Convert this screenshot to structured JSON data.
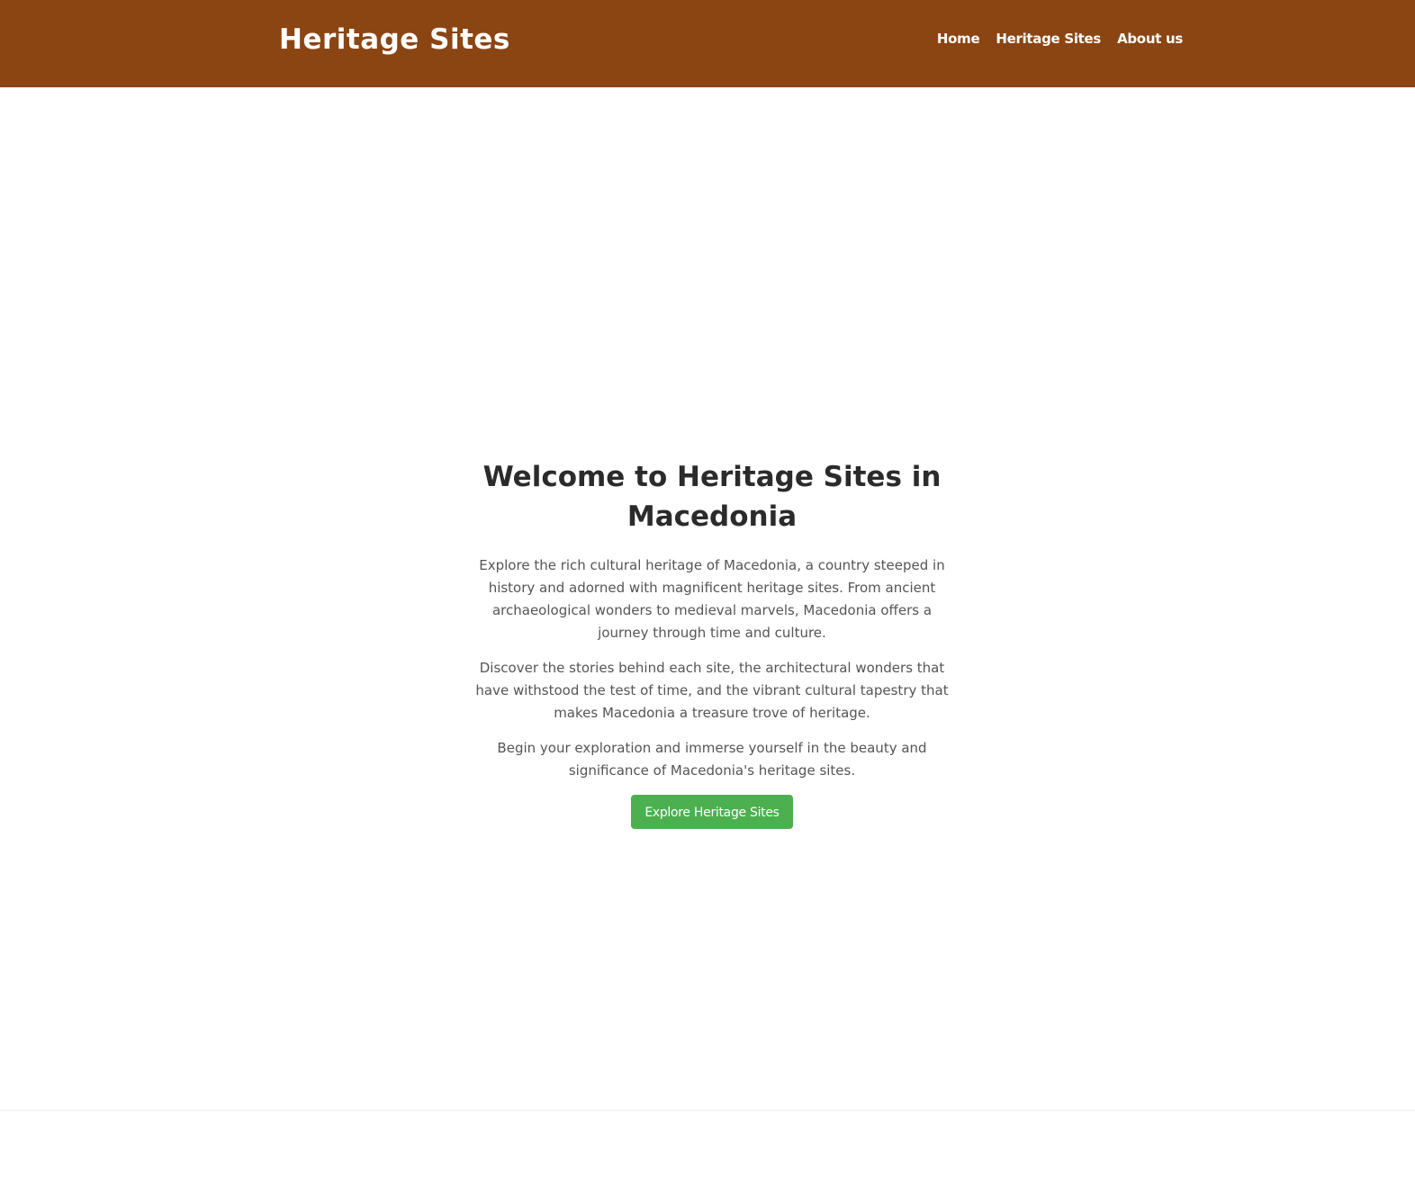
{
  "header": {
    "brand": "Heritage Sites",
    "nav": [
      {
        "label": "Home"
      },
      {
        "label": "Heritage Sites"
      },
      {
        "label": "About us"
      }
    ]
  },
  "hero": {
    "title": "Welcome to Heritage Sites in Macedonia",
    "paragraphs": [
      "Explore the rich cultural heritage of Macedonia, a country steeped in history and adorned with magnificent heritage sites. From ancient archaeological wonders to medieval marvels, Macedonia offers a journey through time and culture.",
      "Discover the stories behind each site, the architectural wonders that have withstood the test of time, and the vibrant cultural tapestry that makes Macedonia a treasure trove of heritage.",
      "Begin your exploration and immerse yourself in the beauty and significance of Macedonia's heritage sites."
    ],
    "cta_label": "Explore Heritage Sites"
  },
  "colors": {
    "header_bg": "#8b4513",
    "cta_bg": "#4caf50"
  }
}
